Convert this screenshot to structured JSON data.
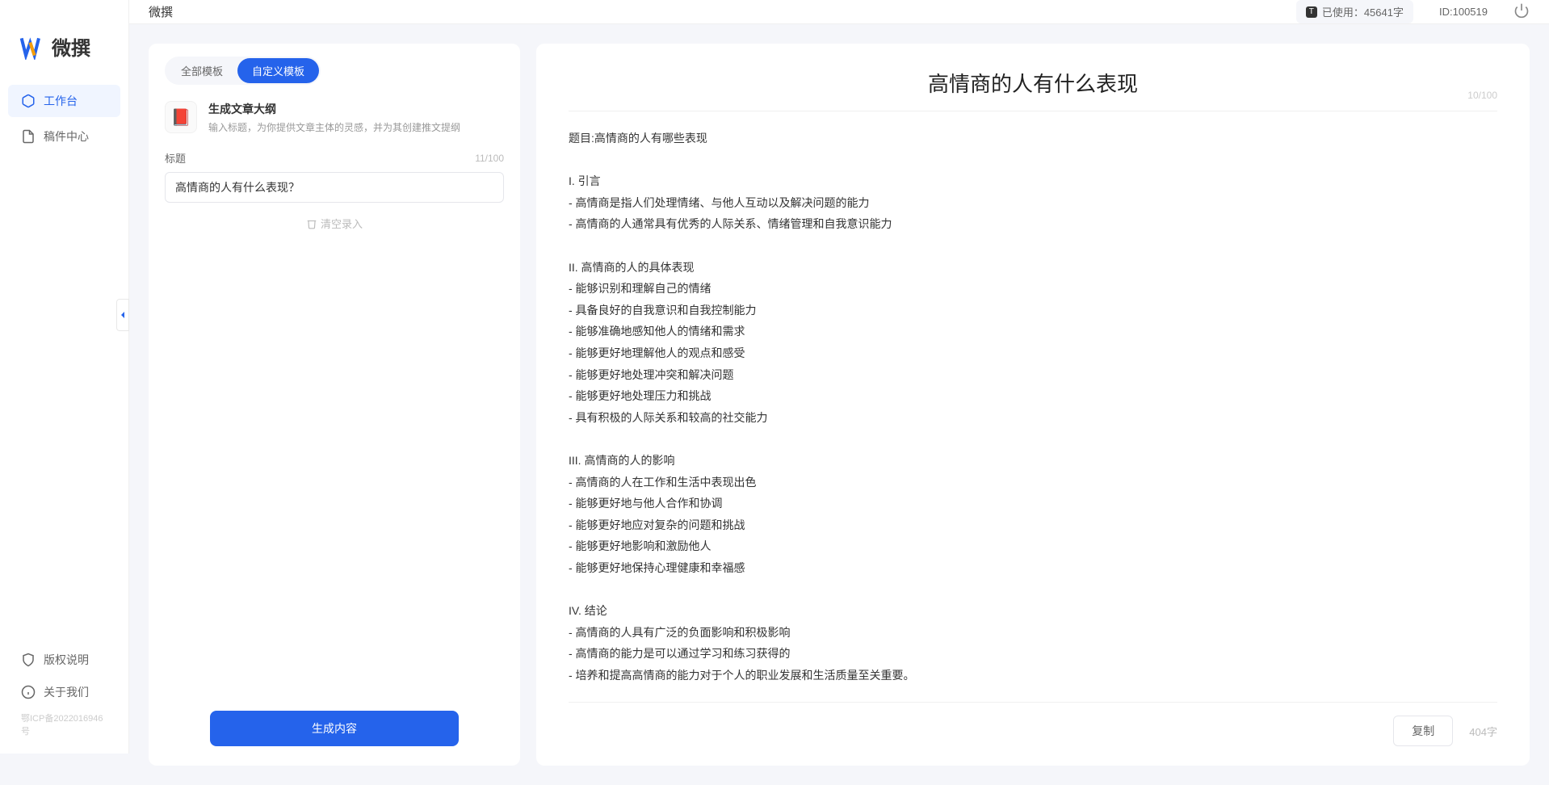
{
  "app": {
    "logo_text": "微撰"
  },
  "sidebar": {
    "nav": [
      {
        "label": "工作台",
        "active": true
      },
      {
        "label": "稿件中心",
        "active": false
      }
    ],
    "bottom": [
      {
        "label": "版权说明"
      },
      {
        "label": "关于我们"
      }
    ],
    "icp": "鄂ICP备2022016946号"
  },
  "topbar": {
    "title": "微撰",
    "usage_label": "已使用：",
    "usage_value": "45641字",
    "id_label": "ID:",
    "id_value": "100519"
  },
  "leftPanel": {
    "tabs": [
      {
        "label": "全部模板",
        "active": false
      },
      {
        "label": "自定义模板",
        "active": true
      }
    ],
    "template": {
      "icon_glyph": "📕",
      "title": "生成文章大纲",
      "desc": "输入标题，为你提供文章主体的灵感，并为其创建推文提纲"
    },
    "form": {
      "title_label": "标题",
      "title_counter": "11/100",
      "title_value": "高情商的人有什么表现？",
      "clear_label": "清空录入"
    },
    "generate_label": "生成内容"
  },
  "result": {
    "title": "高情商的人有什么表现",
    "title_counter": "10/100",
    "body": "题目:高情商的人有哪些表现\n\nI. 引言\n- 高情商是指人们处理情绪、与他人互动以及解决问题的能力\n- 高情商的人通常具有优秀的人际关系、情绪管理和自我意识能力\n\nII. 高情商的人的具体表现\n- 能够识别和理解自己的情绪\n- 具备良好的自我意识和自我控制能力\n- 能够准确地感知他人的情绪和需求\n- 能够更好地理解他人的观点和感受\n- 能够更好地处理冲突和解决问题\n- 能够更好地处理压力和挑战\n- 具有积极的人际关系和较高的社交能力\n\nIII. 高情商的人的影响\n- 高情商的人在工作和生活中表现出色\n- 能够更好地与他人合作和协调\n- 能够更好地应对复杂的问题和挑战\n- 能够更好地影响和激励他人\n- 能够更好地保持心理健康和幸福感\n\nIV. 结论\n- 高情商的人具有广泛的负面影响和积极影响\n- 高情商的能力是可以通过学习和练习获得的\n- 培养和提高高情商的能力对于个人的职业发展和生活质量至关重要。",
    "copy_label": "复制",
    "word_count": "404字"
  }
}
